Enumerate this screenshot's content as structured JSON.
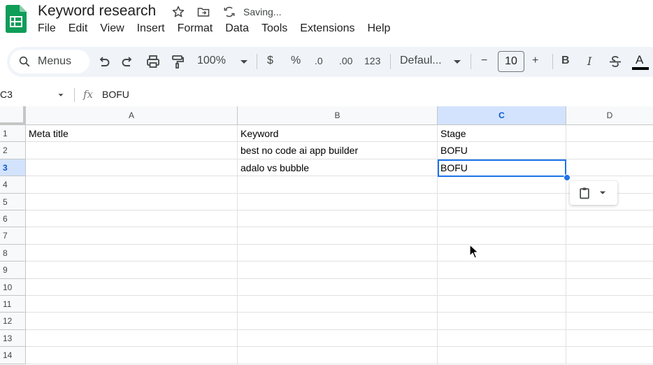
{
  "app": {
    "doc_title": "Keyword research",
    "status_text": "Saving...",
    "colors": {
      "sheets_green": "#0f9d58",
      "selection_blue": "#1a73e8",
      "toolbar_bg": "#f0f4f9"
    }
  },
  "menu": {
    "items": [
      "File",
      "Edit",
      "View",
      "Insert",
      "Format",
      "Data",
      "Tools",
      "Extensions",
      "Help"
    ]
  },
  "toolbar": {
    "search_label": "Menus",
    "zoom": "100%",
    "currency": "$",
    "percent": "%",
    "decrease_decimal": ".0",
    "increase_decimal": ".00",
    "number_format": "123",
    "font_family": "Defaul...",
    "font_size": "10",
    "minus": "−",
    "plus": "+",
    "bold": "B",
    "italic": "I",
    "text_color": "A",
    "icons": [
      "search-icon",
      "undo-icon",
      "redo-icon",
      "print-icon",
      "paint-format-icon",
      "dropdown-icon",
      "bold-icon",
      "italic-icon",
      "strikethrough-icon",
      "text-color-icon"
    ]
  },
  "formula_bar": {
    "name_box": "C3",
    "fx": "fx",
    "value": "BOFU"
  },
  "sheet": {
    "columns": [
      "A",
      "B",
      "C",
      "D"
    ],
    "selected_column": "C",
    "selected_row": "3",
    "rows": [
      {
        "num": "1",
        "cells": [
          "Meta title",
          "Keyword",
          "Stage",
          ""
        ]
      },
      {
        "num": "2",
        "cells": [
          "",
          "best no code ai app builder",
          "BOFU",
          ""
        ]
      },
      {
        "num": "3",
        "cells": [
          "",
          "adalo vs bubble",
          "BOFU",
          ""
        ]
      },
      {
        "num": "4",
        "cells": [
          "",
          "",
          "",
          ""
        ]
      },
      {
        "num": "5",
        "cells": [
          "",
          "",
          "",
          ""
        ]
      },
      {
        "num": "6",
        "cells": [
          "",
          "",
          "",
          ""
        ]
      },
      {
        "num": "7",
        "cells": [
          "",
          "",
          "",
          ""
        ]
      },
      {
        "num": "8",
        "cells": [
          "",
          "",
          "",
          ""
        ]
      },
      {
        "num": "9",
        "cells": [
          "",
          "",
          "",
          ""
        ]
      },
      {
        "num": "10",
        "cells": [
          "",
          "",
          "",
          ""
        ]
      },
      {
        "num": "11",
        "cells": [
          "",
          "",
          "",
          ""
        ]
      },
      {
        "num": "12",
        "cells": [
          "",
          "",
          "",
          ""
        ]
      },
      {
        "num": "13",
        "cells": [
          "",
          "",
          "",
          ""
        ]
      },
      {
        "num": "14",
        "cells": [
          "",
          "",
          "",
          ""
        ]
      }
    ]
  }
}
